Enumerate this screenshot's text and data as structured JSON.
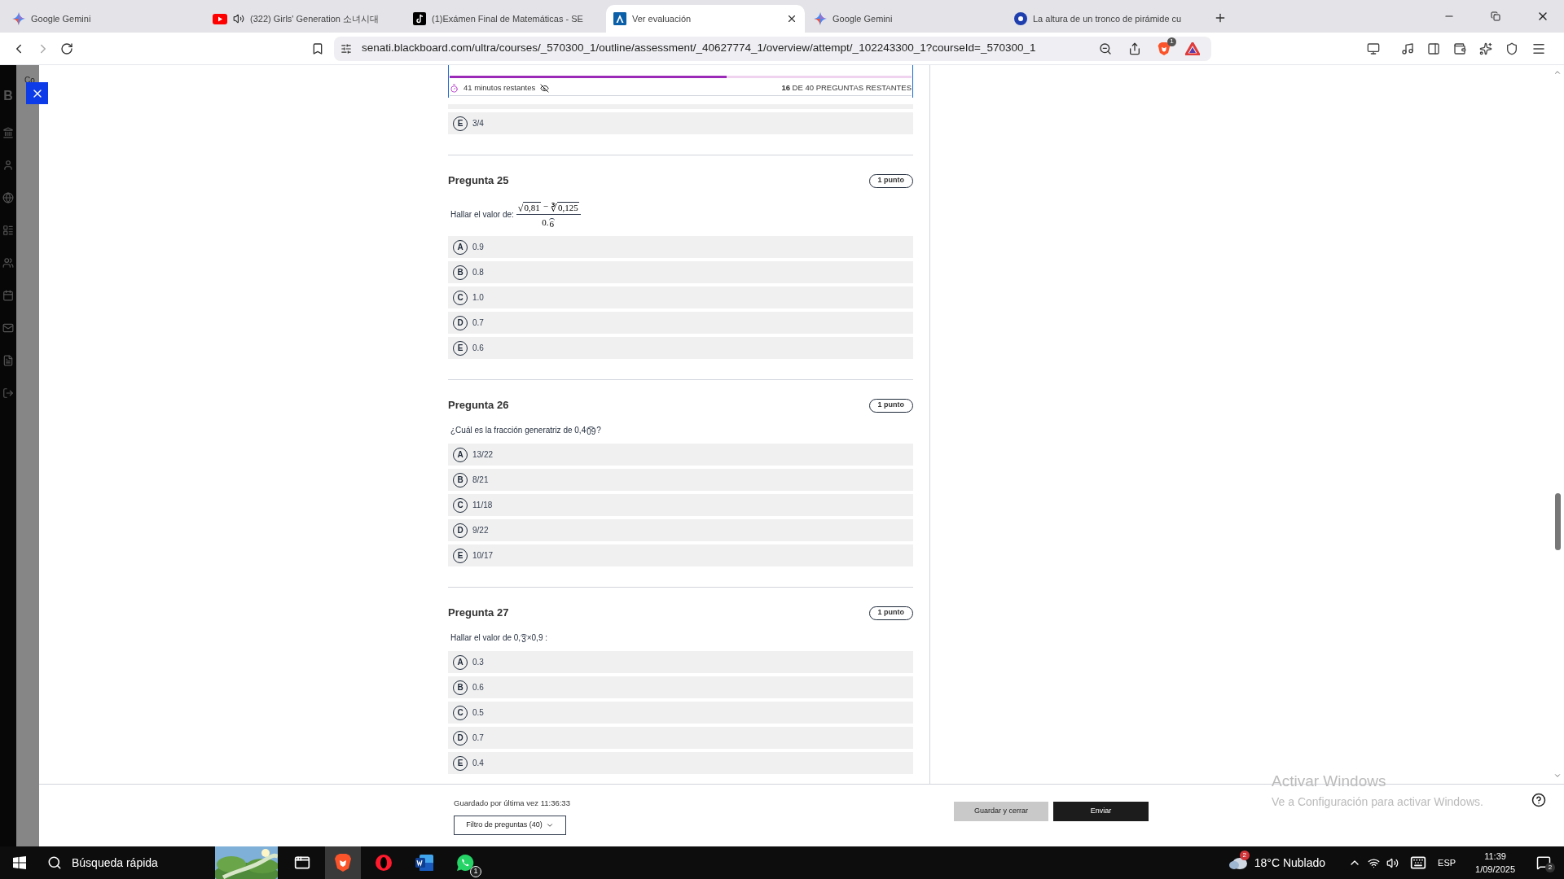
{
  "browser": {
    "tabs": [
      {
        "title": "Google Gemini",
        "audio": false,
        "selected": false
      },
      {
        "title": "(322) Girls' Generation 소녀시대",
        "audio": true,
        "selected": false
      },
      {
        "title": "(1)Exámen Final de Matemáticas - SE",
        "audio": false,
        "selected": false
      },
      {
        "title": "Ver evaluación",
        "audio": false,
        "selected": true
      },
      {
        "title": "Google Gemini",
        "audio": false,
        "selected": false
      },
      {
        "title": "La altura de un tronco de pirámide cu",
        "audio": false,
        "selected": false
      }
    ],
    "url": "senati.blackboard.com/ultra/courses/_570300_1/outline/assessment/_40627774_1/overview/attempt/_102243300_1?courseId=_570300_1",
    "shields_badge": "1"
  },
  "sidebar": {
    "course_initials": "Co",
    "logo_letter": "B"
  },
  "progress": {
    "level": 0.6,
    "time_left": "41 minutos restantes",
    "remaining_count": "16",
    "remaining_label": "DE 40 PREGUNTAS RESTANTES"
  },
  "previous_question": {
    "options": [
      {
        "letter": "E",
        "text": "3/4",
        "selected": false
      }
    ]
  },
  "questions": [
    {
      "title": "Pregunta 25",
      "points": "1 punto",
      "prompt": [
        {
          "kind": "text",
          "text": "Hallar el valor de:"
        },
        {
          "kind": "fraction",
          "numerator": [
            {
              "kind": "root",
              "radical": "√",
              "radicand": "0,81"
            },
            {
              "kind": "text",
              "text": "−"
            },
            {
              "kind": "root",
              "radical": "∛",
              "radicand": "0,125"
            }
          ],
          "denominator": [
            {
              "kind": "text",
              "text": "0."
            },
            {
              "kind": "periodic",
              "text": "6"
            }
          ]
        }
      ],
      "options": [
        {
          "letter": "A",
          "text": "0.9",
          "selected": false
        },
        {
          "letter": "B",
          "text": "0.8",
          "selected": false
        },
        {
          "letter": "C",
          "text": "1.0",
          "selected": false
        },
        {
          "letter": "D",
          "text": "0.7",
          "selected": false
        },
        {
          "letter": "E",
          "text": "0.6",
          "selected": false
        }
      ]
    },
    {
      "title": "Pregunta 26",
      "points": "1 punto",
      "prompt": [
        {
          "kind": "text",
          "text": "¿Cuál es la fracción generatriz de 0,4"
        },
        {
          "kind": "periodic",
          "text": "09"
        },
        {
          "kind": "text",
          "text": "?"
        }
      ],
      "options": [
        {
          "letter": "A",
          "text": "13/22",
          "selected": false
        },
        {
          "letter": "B",
          "text": "8/21",
          "selected": false
        },
        {
          "letter": "C",
          "text": "11/18",
          "selected": false
        },
        {
          "letter": "D",
          "text": "9/22",
          "selected": false
        },
        {
          "letter": "E",
          "text": "10/17",
          "selected": false
        }
      ]
    },
    {
      "title": "Pregunta 27",
      "points": "1 punto",
      "prompt": [
        {
          "kind": "text",
          "text": "Hallar el valor de 0,"
        },
        {
          "kind": "periodic",
          "text": "3"
        },
        {
          "kind": "text",
          "text": "×0,9 :"
        }
      ],
      "options": [
        {
          "letter": "A",
          "text": "0.3",
          "selected": false
        },
        {
          "letter": "B",
          "text": "0.6",
          "selected": false
        },
        {
          "letter": "C",
          "text": "0.5",
          "selected": false
        },
        {
          "letter": "D",
          "text": "0.7",
          "selected": false
        },
        {
          "letter": "E",
          "text": "0.4",
          "selected": false
        }
      ]
    }
  ],
  "footer": {
    "saved": "Guardado por última vez 11:36:33",
    "filter": "Filtro de preguntas (40)",
    "save_close": "Guardar y cerrar",
    "submit": "Enviar"
  },
  "windows_notice": {
    "title": "Activar Windows",
    "subtitle": "Ve a Configuración para activar Windows."
  },
  "taskbar": {
    "search_placeholder": "Búsqueda rápida",
    "apps": [
      {
        "kind": "task_view",
        "selected": false
      },
      {
        "kind": "brave",
        "selected": true
      },
      {
        "kind": "opera",
        "selected": false
      },
      {
        "kind": "word",
        "selected": false
      },
      {
        "kind": "whatsapp",
        "selected": false,
        "badge": "1"
      }
    ],
    "weather": {
      "badge": "2",
      "temperature": "18°C",
      "condition": "Nublado"
    },
    "language": "ESP",
    "time": "11:39",
    "date": "1/09/2025",
    "notifications": "2"
  }
}
